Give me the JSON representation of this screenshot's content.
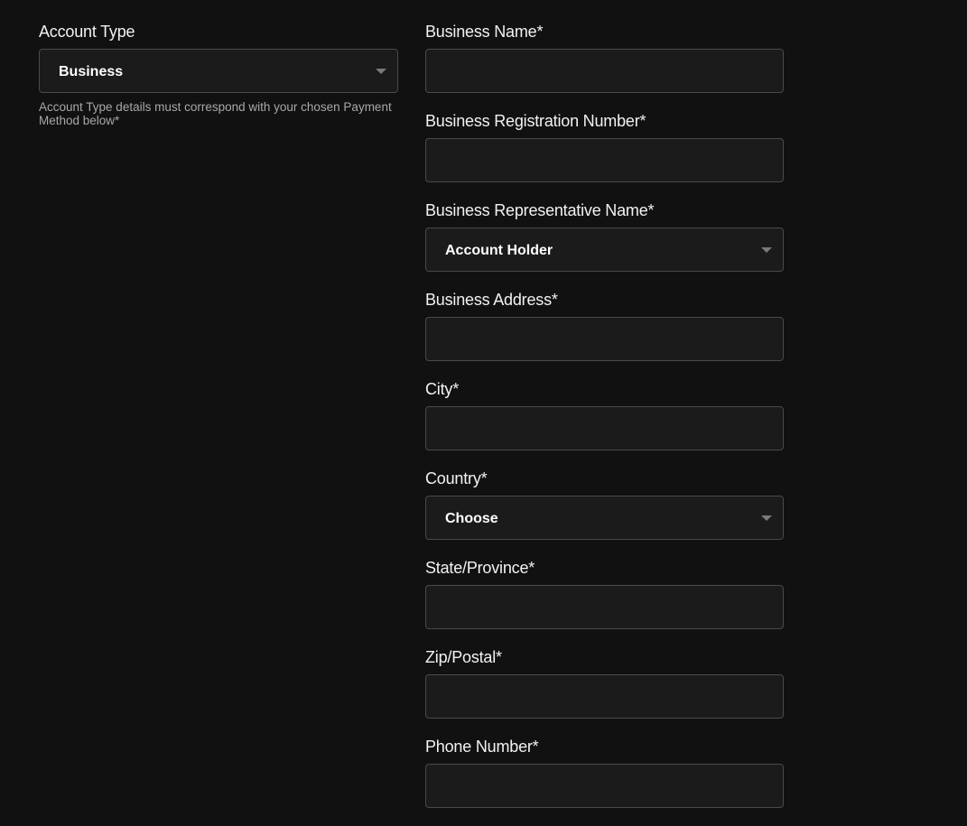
{
  "account_type": {
    "label": "Account Type",
    "selected": "Business",
    "help_text": "Account Type details must correspond with your chosen Payment Method below*"
  },
  "fields": [
    {
      "label": "Business Name*",
      "type": "input",
      "value": ""
    },
    {
      "label": "Business Registration Number*",
      "type": "input",
      "value": ""
    },
    {
      "label": "Business Representative Name*",
      "type": "select",
      "selected": "Account Holder"
    },
    {
      "label": "Business Address*",
      "type": "input",
      "value": ""
    },
    {
      "label": "City*",
      "type": "input",
      "value": ""
    },
    {
      "label": "Country*",
      "type": "select",
      "selected": "Choose"
    },
    {
      "label": "State/Province*",
      "type": "input",
      "value": ""
    },
    {
      "label": "Zip/Postal*",
      "type": "input",
      "value": ""
    },
    {
      "label": "Phone Number*",
      "type": "input",
      "value": ""
    }
  ],
  "icons": {
    "select_caret": "chevron-down-icon"
  },
  "colors": {
    "background": "#111111",
    "field_bg": "#1b1b1b",
    "field_border": "#4a4a4a",
    "help_text": "#a8a8a8"
  }
}
